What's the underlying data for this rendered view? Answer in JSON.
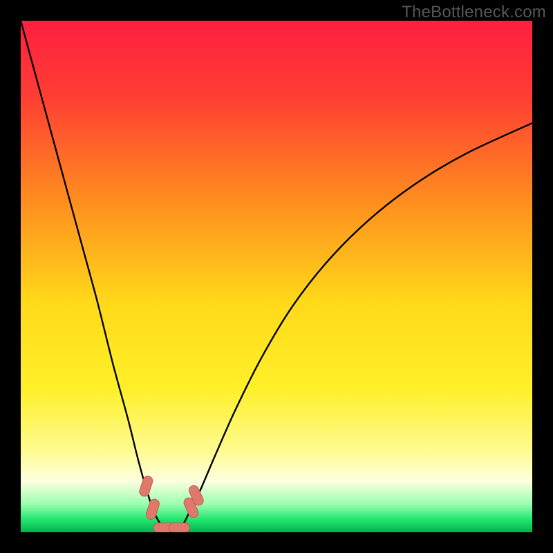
{
  "watermark": "TheBottleneck.com",
  "chart_data": {
    "type": "line",
    "title": "",
    "xlabel": "",
    "ylabel": "",
    "xlim": [
      0,
      100
    ],
    "ylim": [
      0,
      100
    ],
    "series": [
      {
        "name": "curve",
        "x": [
          0,
          3,
          6,
          9,
          12,
          15,
          18,
          21,
          23,
          25,
          26.5,
          28,
          30,
          31,
          32,
          33,
          35,
          38,
          42,
          47,
          53,
          60,
          68,
          77,
          87,
          100
        ],
        "y": [
          100,
          89,
          78,
          67,
          56,
          45,
          33,
          22,
          14,
          7,
          3,
          1,
          0.5,
          1,
          2,
          4,
          8,
          15,
          24,
          34,
          44,
          53,
          61,
          68,
          74,
          80
        ]
      }
    ],
    "markers": [
      {
        "x": 24.5,
        "y": 9.0,
        "angle": -72
      },
      {
        "x": 25.8,
        "y": 4.5,
        "angle": -72
      },
      {
        "x": 28.0,
        "y": 0.9,
        "angle": 0
      },
      {
        "x": 31.0,
        "y": 0.9,
        "angle": 0
      },
      {
        "x": 33.3,
        "y": 4.8,
        "angle": 65
      },
      {
        "x": 34.3,
        "y": 7.2,
        "angle": 65
      }
    ],
    "gradient_stops": [
      {
        "offset": 0.0,
        "color": "#ff1f3f"
      },
      {
        "offset": 0.15,
        "color": "#ff3e33"
      },
      {
        "offset": 0.35,
        "color": "#ff8d1f"
      },
      {
        "offset": 0.55,
        "color": "#ffd91a"
      },
      {
        "offset": 0.72,
        "color": "#fff029"
      },
      {
        "offset": 0.84,
        "color": "#fffb90"
      },
      {
        "offset": 0.9,
        "color": "#fdffe0"
      },
      {
        "offset": 0.945,
        "color": "#9bffb0"
      },
      {
        "offset": 0.975,
        "color": "#22e66e"
      },
      {
        "offset": 1.0,
        "color": "#03b14e"
      }
    ],
    "colors": {
      "curve": "#000000",
      "marker_fill": "#e0786b",
      "marker_stroke": "#c25a50",
      "background": "#000000"
    }
  }
}
